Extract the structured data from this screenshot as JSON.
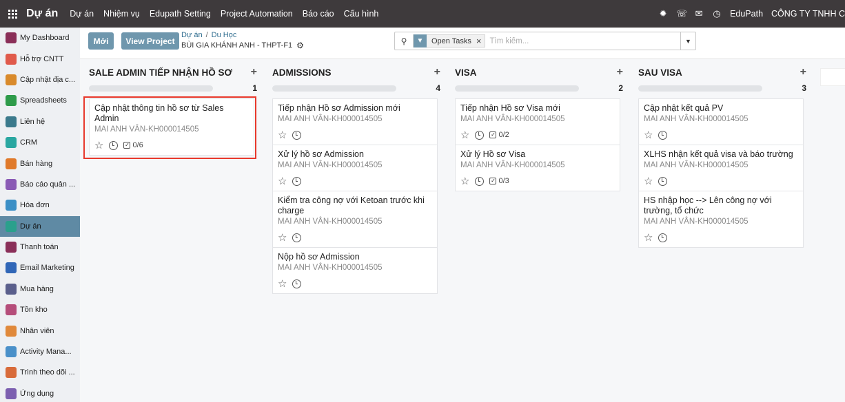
{
  "navbar": {
    "brand": "Dự án",
    "menu": [
      "Dự án",
      "Nhiệm vụ",
      "Edupath Setting",
      "Project Automation",
      "Báo cáo",
      "Cấu hình"
    ],
    "right": {
      "company_short": "EduPath",
      "company_long": "CÔNG TY TNHH C"
    }
  },
  "sidebar": {
    "items": [
      {
        "label": "My Dashboard",
        "color": "#8a2f58"
      },
      {
        "label": "Hỗ trợ CNTT",
        "color": "#e05a4b"
      },
      {
        "label": "Cập nhật địa c...",
        "color": "#d98a2b"
      },
      {
        "label": "Spreadsheets",
        "color": "#2e9b4a"
      },
      {
        "label": "Liên hệ",
        "color": "#3b7a8c"
      },
      {
        "label": "CRM",
        "color": "#2aa7a1"
      },
      {
        "label": "Bán hàng",
        "color": "#e07a2b"
      },
      {
        "label": "Báo cáo quản ...",
        "color": "#8a5bb5"
      },
      {
        "label": "Hóa đơn",
        "color": "#3a8fc6"
      },
      {
        "label": "Dự án",
        "color": "#2aa08c"
      },
      {
        "label": "Thanh toán",
        "color": "#8a2f58"
      },
      {
        "label": "Email Marketing",
        "color": "#3066b7"
      },
      {
        "label": "Mua hàng",
        "color": "#5a5f8c"
      },
      {
        "label": "Tồn kho",
        "color": "#b54d7a"
      },
      {
        "label": "Nhân viên",
        "color": "#e0893b"
      },
      {
        "label": "Activity Mana...",
        "color": "#4a90c9"
      },
      {
        "label": "Trình theo dõi ...",
        "color": "#d86b3a"
      },
      {
        "label": "Ứng dụng",
        "color": "#7c5fb0"
      }
    ],
    "active_index": 9
  },
  "control_panel": {
    "new_label": "Mới",
    "view_project_label": "View Project",
    "breadcrumb": [
      "Dự án",
      "Du Học"
    ],
    "project_name": "BÙI GIA KHÁNH ANH - THPT-F1",
    "search": {
      "facet_label": "Open Tasks",
      "placeholder": "Tìm kiếm..."
    }
  },
  "kanban": {
    "columns": [
      {
        "title": "SALE ADMIN TIẾP NHẬN HỒ SƠ",
        "count": "1",
        "cards": [
          {
            "title": "Cập nhật thông tin hồ sơ từ Sales Admin",
            "sub": "MAI ANH VÂN-KH000014505",
            "checklist": "0/6"
          }
        ]
      },
      {
        "title": "ADMISSIONS",
        "count": "4",
        "cards": [
          {
            "title": "Tiếp nhận Hồ sơ Admission mới",
            "sub": "MAI ANH VÂN-KH000014505",
            "checklist": ""
          },
          {
            "title": "Xử lý hồ sơ Admission",
            "sub": "MAI ANH VÂN-KH000014505",
            "checklist": ""
          },
          {
            "title": "Kiểm tra công nợ với Ketoan trước khi charge",
            "sub": "MAI ANH VÂN-KH000014505",
            "checklist": ""
          },
          {
            "title": "Nộp hồ sơ Admission",
            "sub": "MAI ANH VÂN-KH000014505",
            "checklist": ""
          }
        ]
      },
      {
        "title": "VISA",
        "count": "2",
        "cards": [
          {
            "title": "Tiếp nhận Hồ sơ Visa mới",
            "sub": "MAI ANH VÂN-KH000014505",
            "checklist": "0/2"
          },
          {
            "title": "Xử lý Hồ sơ Visa",
            "sub": "MAI ANH VÂN-KH000014505",
            "checklist": "0/3"
          }
        ]
      },
      {
        "title": "SAU VISA",
        "count": "3",
        "cards": [
          {
            "title": "Cập nhật kết quả PV",
            "sub": "MAI ANH VÂN-KH000014505",
            "checklist": ""
          },
          {
            "title": "XLHS nhận kết quả visa và báo trường",
            "sub": "MAI ANH VÂN-KH000014505",
            "checklist": ""
          },
          {
            "title": "HS nhập học --> Lên công nợ với trường, tổ chức",
            "sub": "MAI ANH VÂN-KH000014505",
            "checklist": ""
          }
        ]
      }
    ]
  },
  "colors": {
    "navbar_bg": "#3e3a3c",
    "accent": "#6f97ad",
    "highlight": "#e8382c"
  }
}
